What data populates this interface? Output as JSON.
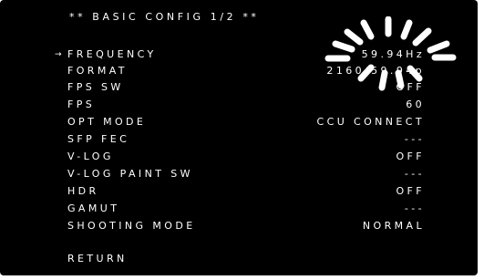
{
  "osd": {
    "title": "** BASIC CONFIG 1/2 **",
    "cursor_glyph": "→",
    "menu": [
      {
        "label": "FREQUENCY",
        "value": "59.94Hz",
        "selected": true
      },
      {
        "label": "FORMAT",
        "value": "2160/59.94p",
        "selected": false
      },
      {
        "label": "FPS SW",
        "value": "OFF",
        "selected": false
      },
      {
        "label": "FPS",
        "value": "60",
        "selected": false
      },
      {
        "label": "OPT MODE",
        "value": "CCU CONNECT",
        "selected": false
      },
      {
        "label": "SFP FEC",
        "value": "---",
        "selected": false
      },
      {
        "label": "V-LOG",
        "value": "OFF",
        "selected": false
      },
      {
        "label": "V-LOG PAINT SW",
        "value": "---",
        "selected": false
      },
      {
        "label": "HDR",
        "value": "OFF",
        "selected": false
      },
      {
        "label": "GAMUT",
        "value": "---",
        "selected": false
      },
      {
        "label": "SHOOTING MODE",
        "value": "NORMAL",
        "selected": false
      }
    ],
    "return_label": "RETURN",
    "spinner_icon": "busy-spinner-icon"
  },
  "colors": {
    "background": "#000000",
    "text": "#ffffff",
    "spinner": "#ffffff",
    "frame": "#ffffff"
  }
}
